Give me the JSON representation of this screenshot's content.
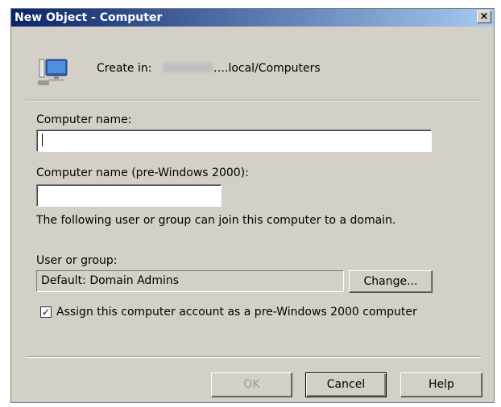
{
  "window": {
    "title": "New Object - Computer",
    "close_glyph": "×"
  },
  "header": {
    "create_in_label": "Create in:",
    "create_in_value": "….local/Computers",
    "icon": "computer-icon"
  },
  "form": {
    "computer_name_label": "Computer name:",
    "computer_name_value": "",
    "pre2000_label": "Computer name (pre-Windows 2000):",
    "pre2000_value": "",
    "join_info": "The following user or group can join this computer to a domain.",
    "user_group_label": "User or group:",
    "user_group_value": "Default: Domain Admins",
    "change_button": "Change...",
    "checkbox_label": "Assign this computer account as a pre-Windows 2000 computer",
    "checkbox_checked": true,
    "checkbox_glyph": "✓"
  },
  "footer": {
    "ok_label": "OK",
    "cancel_label": "Cancel",
    "help_label": "Help"
  }
}
